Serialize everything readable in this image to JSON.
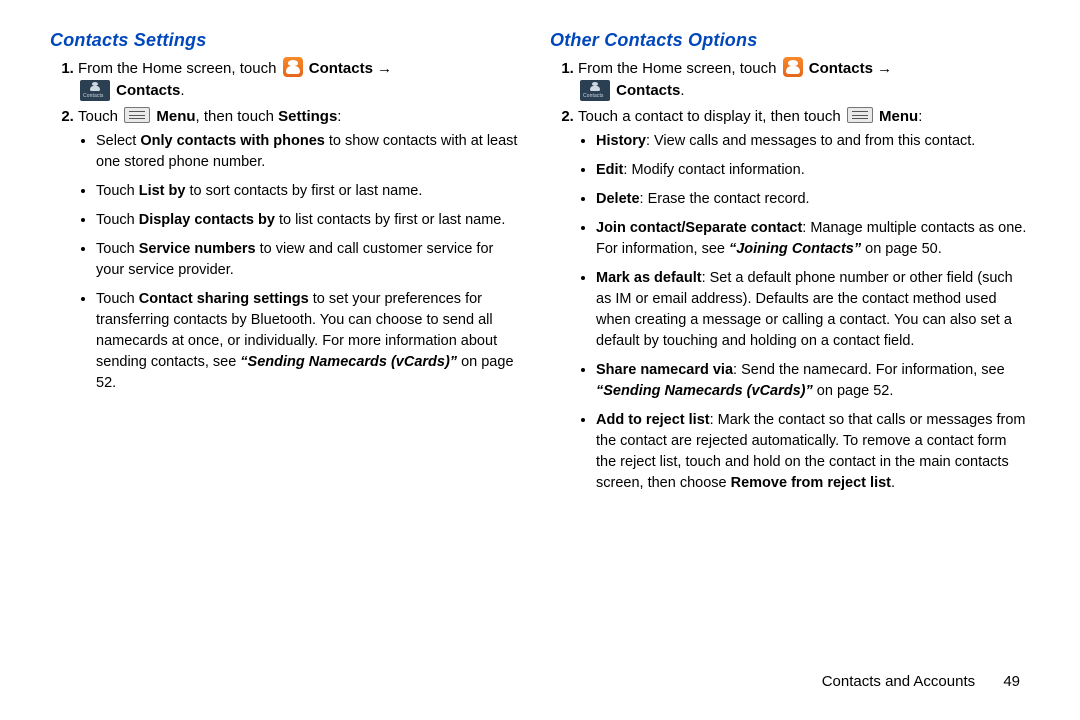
{
  "left": {
    "title": "Contacts Settings",
    "step1_a": "From the Home screen, touch ",
    "step1_b": "Contacts",
    "step1_c": "Contacts",
    "step2_a": "Touch ",
    "step2_menu": "Menu",
    "step2_b": ", then touch ",
    "step2_settings": "Settings",
    "bullets": {
      "b1_a": "Select ",
      "b1_bold": "Only contacts with phones",
      "b1_b": " to show contacts with at least one stored phone number.",
      "b2_a": "Touch ",
      "b2_bold": "List by",
      "b2_b": " to sort contacts by first or last name.",
      "b3_a": "Touch ",
      "b3_bold": "Display contacts by",
      "b3_b": " to list contacts by first or last name.",
      "b4_a": "Touch ",
      "b4_bold": "Service numbers",
      "b4_b": " to view and call customer service for your service provider.",
      "b5_a": "Touch ",
      "b5_bold": "Contact sharing settings",
      "b5_b": " to set your preferences for transferring contacts by Bluetooth. You can choose to send all namecards at once, or individually. For more information about sending contacts, see ",
      "b5_ref": "“Sending Namecards (vCards)”",
      "b5_c": " on page 52."
    }
  },
  "right": {
    "title": "Other Contacts Options",
    "step1_a": "From the Home screen, touch ",
    "step1_b": "Contacts",
    "step1_c": "Contacts",
    "step2_a": "Touch a contact to display it, then touch ",
    "step2_menu": "Menu",
    "bullets": {
      "h_bold": "History",
      "h_txt": ": View calls and messages to and from this contact.",
      "e_bold": "Edit",
      "e_txt": ": Modify contact information.",
      "d_bold": "Delete",
      "d_txt": ": Erase the contact record.",
      "j_bold": "Join contact/Separate contact",
      "j_txt_a": ": Manage multiple contacts as one. For information, see ",
      "j_ref": "“Joining Contacts”",
      "j_txt_b": " on page 50.",
      "m_bold": "Mark as default",
      "m_txt": ": Set a default phone number or other field (such as IM or email address). Defaults are the contact method used when creating a message or calling a contact. You can also set a default by touching and holding on a contact field.",
      "s_bold": "Share namecard via",
      "s_txt_a": ": Send the namecard. For information, see ",
      "s_ref": "“Sending Namecards (vCards)”",
      "s_txt_b": " on page 52.",
      "r_bold": "Add to reject list",
      "r_txt_a": ": Mark the contact so that calls or messages from the contact are rejected automatically. To remove a contact form the reject list, touch and hold on the contact in the main contacts screen, then choose ",
      "r_bold2": "Remove from reject list",
      "r_txt_b": "."
    }
  },
  "footer": {
    "section": "Contacts and Accounts",
    "page": "49"
  }
}
